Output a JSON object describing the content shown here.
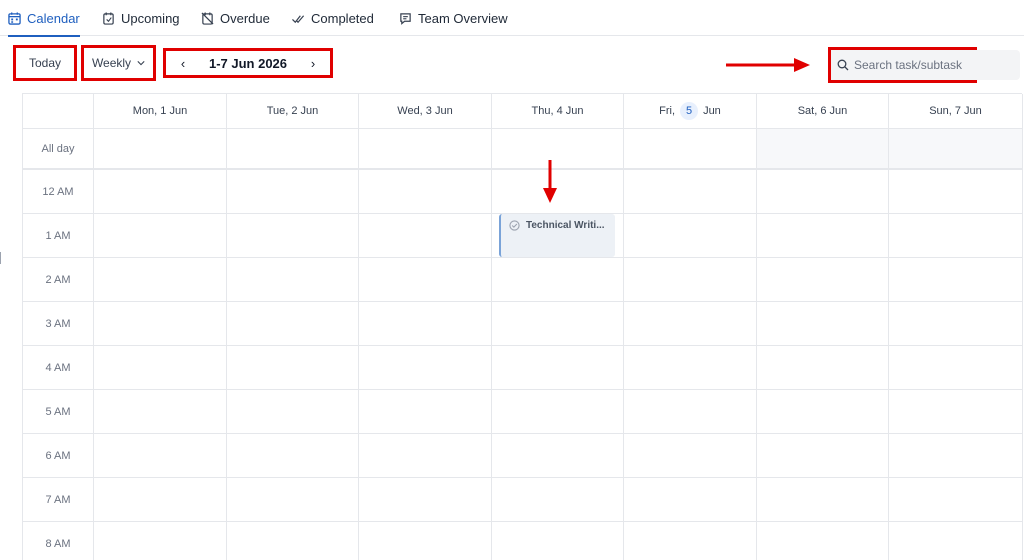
{
  "tabs": [
    {
      "label": "Calendar",
      "icon": "calendar-icon",
      "active": true
    },
    {
      "label": "Upcoming",
      "icon": "upcoming-icon"
    },
    {
      "label": "Overdue",
      "icon": "overdue-icon"
    },
    {
      "label": "Completed",
      "icon": "check-double-icon"
    },
    {
      "label": "Team Overview",
      "icon": "team-overview-icon"
    }
  ],
  "toolbar": {
    "today_label": "Today",
    "view_label": "Weekly",
    "prev_glyph": "‹",
    "next_glyph": "›",
    "range_label": "1-7 Jun 2026",
    "search_placeholder": "Search task/subtask"
  },
  "calendar": {
    "days": [
      {
        "prefix": "Mon, 1 Jun"
      },
      {
        "prefix": "Tue, 2 Jun"
      },
      {
        "prefix": "Wed, 3 Jun"
      },
      {
        "prefix": "Thu, 4 Jun"
      },
      {
        "prefix": "Fri,",
        "num": "5",
        "suffix": "Jun",
        "today": true
      },
      {
        "prefix": "Sat, 6 Jun"
      },
      {
        "prefix": "Sun, 7 Jun"
      }
    ],
    "all_day_label": "All day",
    "hours": [
      "12 AM",
      "1 AM",
      "2 AM",
      "3 AM",
      "4 AM",
      "5 AM",
      "6 AM",
      "7 AM",
      "8 AM"
    ],
    "event": {
      "title": "Technical Writi...",
      "day": "Thu, 4 Jun",
      "hour": "1 AM"
    }
  },
  "colors": {
    "accent": "#1f5fbf",
    "annotation_red": "#e00000",
    "event_bg": "#edf1f6"
  }
}
